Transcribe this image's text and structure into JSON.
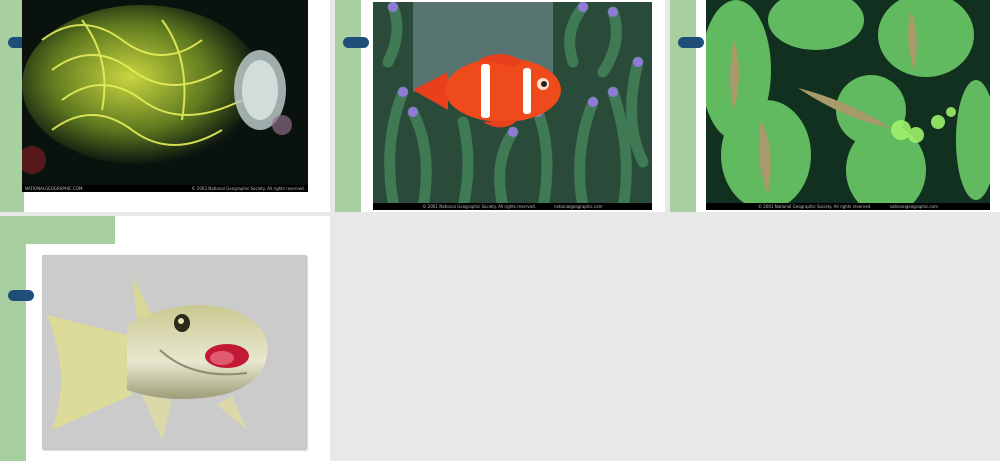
{
  "slides": [
    {
      "id": "slide-1",
      "image_label": "leafy seadragon camouflage",
      "caption_left": "NATIONALGEOGRAPHIC.COM",
      "caption_right": "© 2003 National Geographic Society. All rights reserved."
    },
    {
      "id": "slide-2",
      "image_label": "clownfish in anemone",
      "caption_left": "© 2001 National Geographic Society. All rights reserved.",
      "caption_right": "nationalgeographic.com"
    },
    {
      "id": "slide-3",
      "image_label": "amphibian embryos in eggs",
      "caption_left": "© 2001 National Geographic Society. All rights reserved.",
      "caption_right": "nationalgeographic.com"
    },
    {
      "id": "slide-4",
      "image_label": "fish with open mouth",
      "caption_left": "",
      "caption_right": ""
    }
  ],
  "colors": {
    "accent_green": "#a8cfa0",
    "bullet_navy": "#1f4e79",
    "background": "#e8e8e8"
  }
}
